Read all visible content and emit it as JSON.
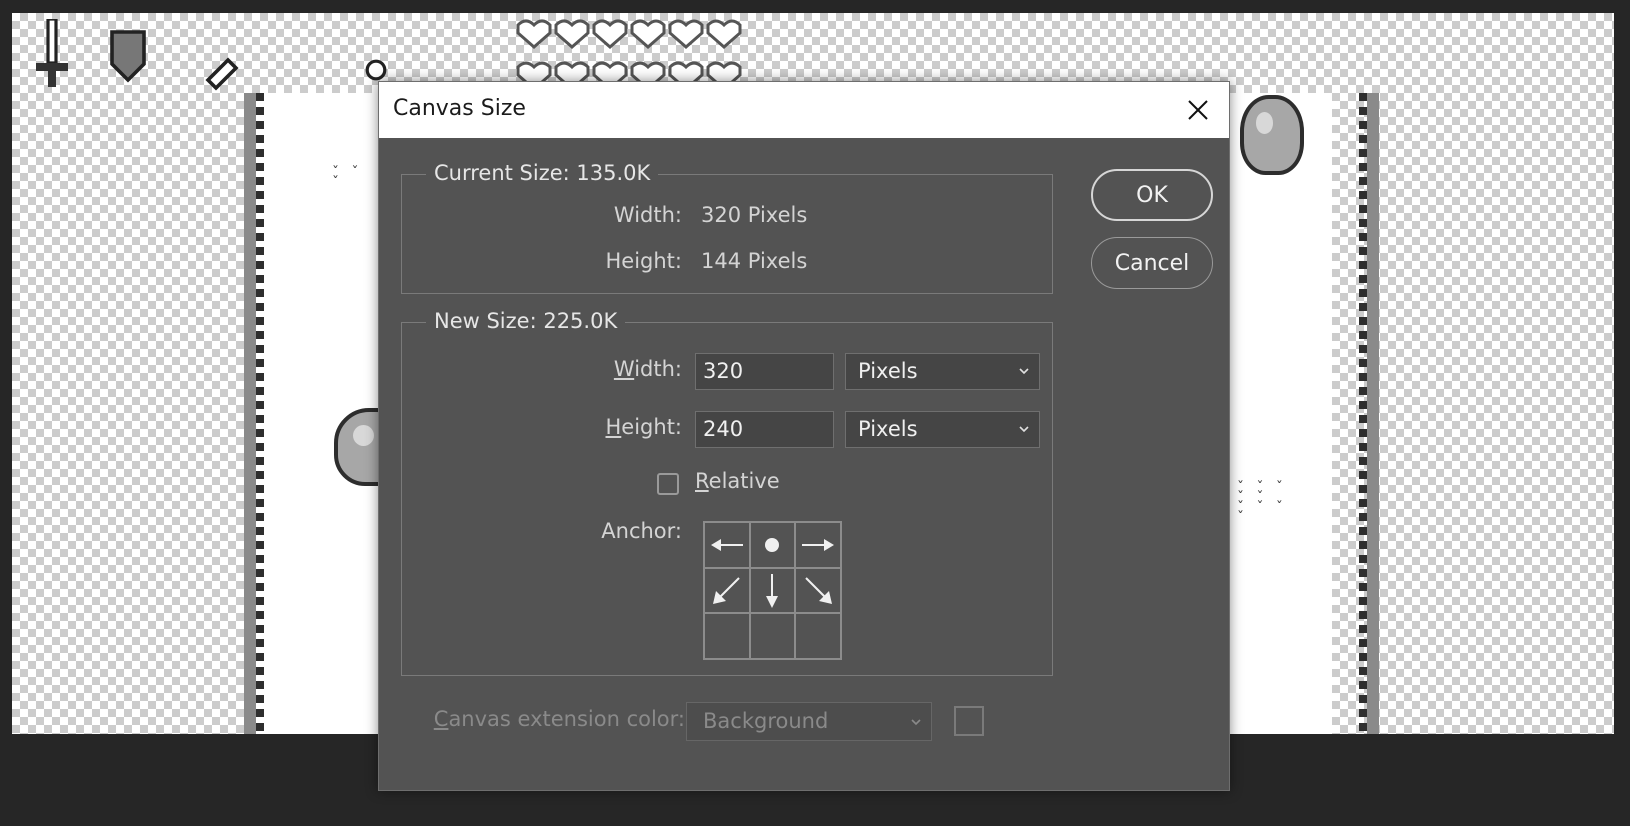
{
  "dialog": {
    "title": "Canvas Size",
    "close_icon": "close-icon",
    "current_size": {
      "legend": "Current Size: 135.0K",
      "width_label": "Width:",
      "width_value": "320 Pixels",
      "height_label": "Height:",
      "height_value": "144 Pixels"
    },
    "new_size": {
      "legend": "New Size: 225.0K",
      "width_label_u": "W",
      "width_label_rest": "idth:",
      "width_value": "320",
      "width_unit": "Pixels",
      "height_label_u": "H",
      "height_label_rest": "eight:",
      "height_value": "240",
      "height_unit": "Pixels",
      "relative_u": "R",
      "relative_rest": "elative",
      "relative_checked": false,
      "anchor_label": "Anchor:",
      "anchor_icons": [
        "arrow-left-icon",
        "anchor-dot-icon",
        "arrow-right-icon",
        "arrow-down-left-icon",
        "arrow-down-icon",
        "arrow-down-right-icon",
        "",
        "",
        ""
      ]
    },
    "extension": {
      "label_u": "C",
      "label_rest": "anvas extension color:",
      "value": "Background",
      "enabled": false
    },
    "buttons": {
      "ok": "OK",
      "cancel": "Cancel"
    }
  },
  "colors": {
    "dialog_bg": "#535353",
    "workspace_bg": "#262626",
    "titlebar_bg": "#ffffff"
  }
}
